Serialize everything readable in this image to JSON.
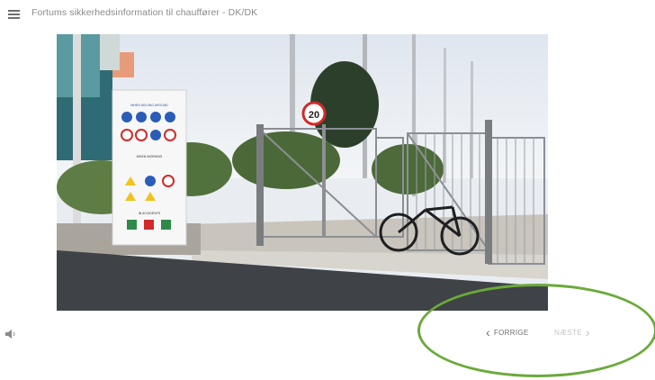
{
  "header": {
    "menu_icon": "hamburger-menu-icon",
    "title": "Fortums sikkerhedsinformation til chauffører - DK/DK"
  },
  "image": {
    "sign_text": {
      "section1": "WHEN MOVING AROUND",
      "section2": "WHEN WORKING",
      "section3": "IN ACCIDENTS"
    },
    "speed_limit": "20"
  },
  "footer": {
    "audio_icon": "speaker-icon",
    "prev_label": "FORRIGE",
    "next_label": "NÆSTE",
    "highlight_color": "#6aaa3a"
  }
}
